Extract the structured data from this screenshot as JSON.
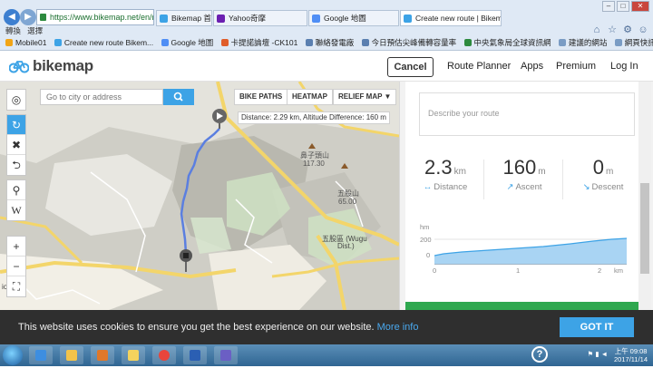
{
  "browser": {
    "address": "https://www.bikemap.net/en/rou",
    "tabs": [
      {
        "label": "Bikemap 首...",
        "color": "#3da3e6"
      },
      {
        "label": "Yahoo奇摩",
        "color": "#6b1fb1"
      },
      {
        "label": "Google 地圖",
        "color": "#4f8ef5"
      },
      {
        "label": "Create new route | Bikema...",
        "color": "#3da3e6"
      }
    ],
    "favorites_toolbar": [
      "轉換",
      "選擇"
    ],
    "bookmarks": [
      "Mobile01",
      "Create new route Bikem...",
      "Google 地圖",
      "卡提諾論壇 -CK101",
      "聯絡發電廠",
      "今日預估尖峰備轉容量率",
      "中央氣象局全球資訊網",
      "建議的網站",
      "網頁快訊圖庫"
    ]
  },
  "header": {
    "logo": "bikemap",
    "cancel": "Cancel",
    "nav": [
      "Route Planner",
      "Apps",
      "Premium",
      "Log In"
    ]
  },
  "map": {
    "search_placeholder": "Go to city or address",
    "toggles": [
      "BIKE PATHS",
      "HEATMAP",
      "RELIEF MAP ▼"
    ],
    "tooltip": "Distance: 2.29 km, Altitude Difference: 160 m",
    "labels": {
      "peak1_name": "鼻子頭山",
      "peak1_alt": "117.30",
      "peak2_name": "五股山",
      "peak2_alt": "65.00",
      "town": "五股區 (Wugu",
      "town2": "Dist.)",
      "left_edge": "ioqi"
    }
  },
  "panel": {
    "description_placeholder": "Describe your route",
    "stats": [
      {
        "value": "2.3",
        "unit": "km",
        "label": "Distance",
        "icon": "↔"
      },
      {
        "value": "160",
        "unit": "m",
        "label": "Ascent",
        "icon": "↗"
      },
      {
        "value": "0",
        "unit": "m",
        "label": "Descent",
        "icon": "↘"
      }
    ],
    "elevation": {
      "unit_y": "hm",
      "y_ticks": [
        "200",
        "0"
      ],
      "x_ticks": [
        "0",
        "1",
        "2"
      ],
      "unit_x": "km"
    }
  },
  "cookie": {
    "text": "This website uses cookies to ensure you get the best experience on our website.",
    "link": "More info",
    "button": "GOT IT"
  },
  "taskbar": {
    "time_label": "上午 09:08",
    "date": "2017/11/14"
  }
}
